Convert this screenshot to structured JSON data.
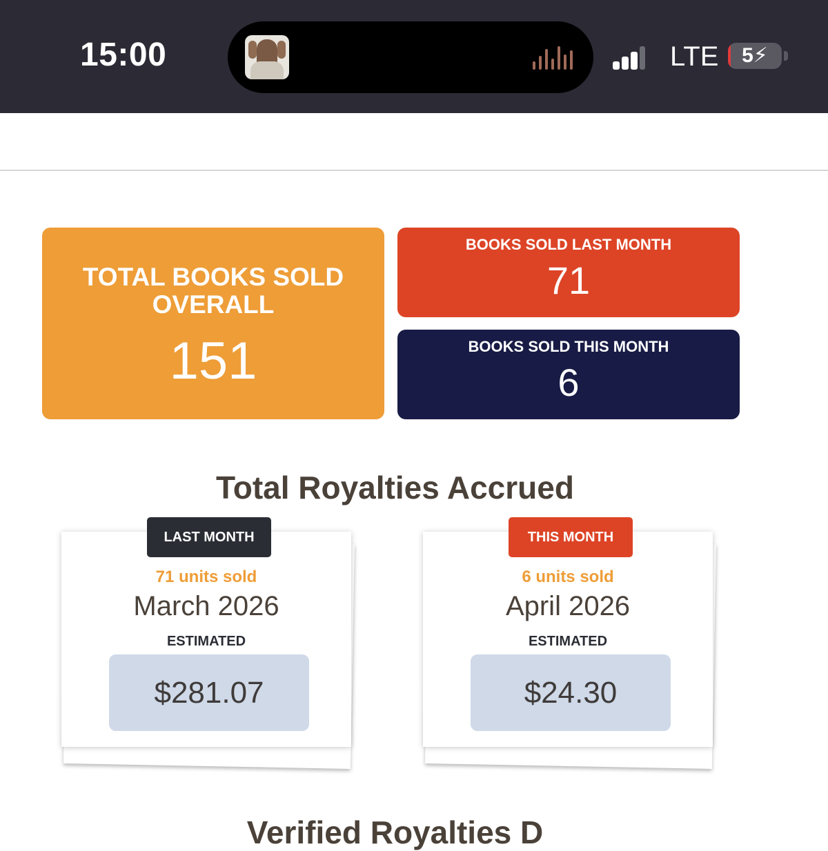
{
  "status_bar": {
    "time": "15:00",
    "network": "LTE",
    "signal_bars_active": 3,
    "signal_bars_total": 4,
    "battery_percent": 5,
    "battery_label": "5",
    "battery_charging": true,
    "icons": [
      "now-playing-artwork",
      "audio-waveform-icon",
      "signal-strength-icon",
      "battery-charging-icon"
    ]
  },
  "stats": {
    "overall": {
      "title": "TOTAL BOOKS SOLD OVERALL",
      "value": "151",
      "color": "#ee9d37"
    },
    "last_month": {
      "title": "BOOKS SOLD LAST MONTH",
      "value": "71",
      "color": "#dd4426"
    },
    "this_month": {
      "title": "BOOKS SOLD THIS MONTH",
      "value": "6",
      "color": "#171b45"
    }
  },
  "royalties": {
    "title": "Total Royalties Accrued",
    "cards": [
      {
        "badge": "LAST MONTH",
        "units": "71 units sold",
        "month": "March 2026",
        "estimated_label": "ESTIMATED",
        "amount": "$281.07",
        "badge_color": "#2b2d35"
      },
      {
        "badge": "THIS MONTH",
        "units": "6 units sold",
        "month": "April 2026",
        "estimated_label": "ESTIMATED",
        "amount": "$24.30",
        "badge_color": "#dd4426"
      }
    ]
  },
  "next_section": {
    "title_partial": "Verified Royalties D"
  },
  "colors": {
    "accent_orange": "#ee9d37",
    "accent_red": "#dd4426",
    "navy": "#171b45",
    "amount_bg": "#cfd9e8",
    "heading": "#4a4139"
  }
}
